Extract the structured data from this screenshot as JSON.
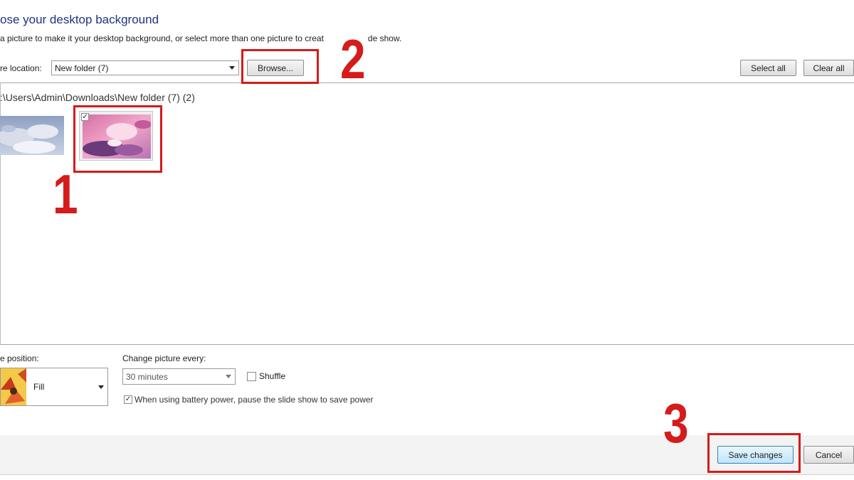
{
  "header": {
    "title": "ose your desktop background",
    "subtitle": "a picture to make it your desktop background, or select more than one picture to creat",
    "subtitle_tail": "de show."
  },
  "location": {
    "label": "re location:",
    "selected": "New folder (7)",
    "browse_label": "Browse...",
    "select_all_label": "Select all",
    "clear_all_label": "Clear all"
  },
  "gallery": {
    "path": ":\\Users\\Admin\\Downloads\\New folder (7) (2)",
    "items": [
      {
        "name": "cloud-wallpaper-1",
        "selected": false
      },
      {
        "name": "cloud-wallpaper-2",
        "selected": true,
        "check": "✓"
      }
    ]
  },
  "options": {
    "position_label": "e position:",
    "position_value": "Fill",
    "change_label": "Change picture every:",
    "interval_value": "30 minutes",
    "shuffle_label": "Shuffle",
    "shuffle_checked": false,
    "battery_label": "When using battery power, pause the slide show to save power",
    "battery_checked": true,
    "battery_check": "✓"
  },
  "footer": {
    "save_label": "Save changes",
    "cancel_label": "Cancel"
  },
  "annotations": {
    "step1": "1",
    "step2": "2",
    "step3": "3",
    "color": "#d51b1b"
  }
}
